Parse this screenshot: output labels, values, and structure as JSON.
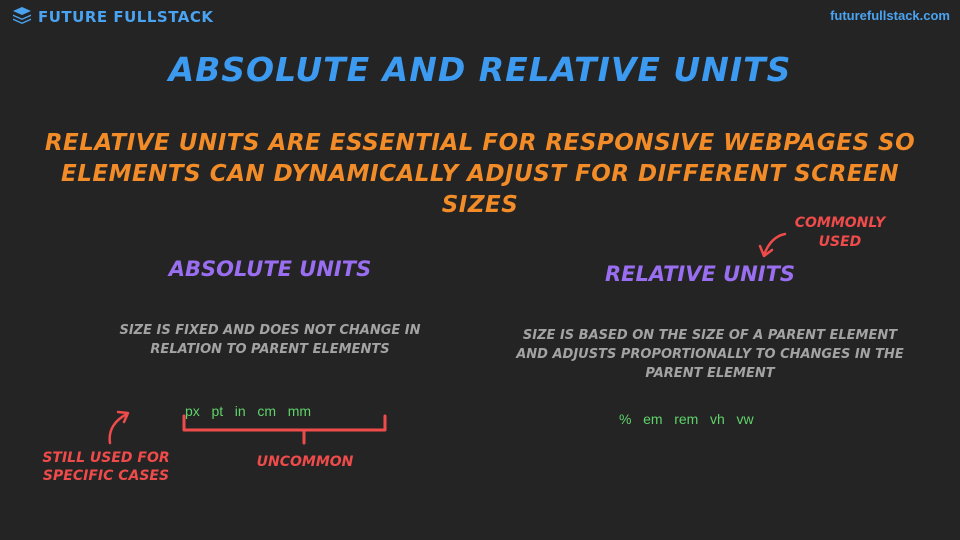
{
  "header": {
    "brand_name": "FUTURE FULLSTACK",
    "site_url": "futurefullstack.com",
    "logo_icon": "stacked-layers-icon"
  },
  "title": "ABSOLUTE AND RELATIVE UNITS",
  "subtitle": "RELATIVE UNITS ARE ESSENTIAL FOR RESPONSIVE WEBPAGES SO ELEMENTS CAN DYNAMICALLY ADJUST FOR DIFFERENT SCREEN SIZES",
  "absolute": {
    "heading": "ABSOLUTE UNITS",
    "description": "SIZE IS FIXED AND DOES NOT CHANGE IN RELATION TO PARENT ELEMENTS",
    "units": "px   pt   in   cm   mm",
    "note_still_used": "STILL USED FOR SPECIFIC CASES",
    "note_uncommon": "UNCOMMON"
  },
  "relative": {
    "heading": "RELATIVE UNITS",
    "description": "SIZE IS BASED ON THE SIZE OF A PARENT ELEMENT AND ADJUSTS PROPORTIONALLY TO CHANGES IN THE PARENT ELEMENT",
    "units": "%   em   rem   vh   vw",
    "note_commonly_used": "COMMONLY USED"
  },
  "colors": {
    "background": "#242424",
    "title_blue": "#3c9bf0",
    "orange": "#f28c28",
    "purple": "#9a6ef0",
    "gray": "#a3a3a3",
    "green": "#5fd36a",
    "red": "#ef4b4b"
  }
}
